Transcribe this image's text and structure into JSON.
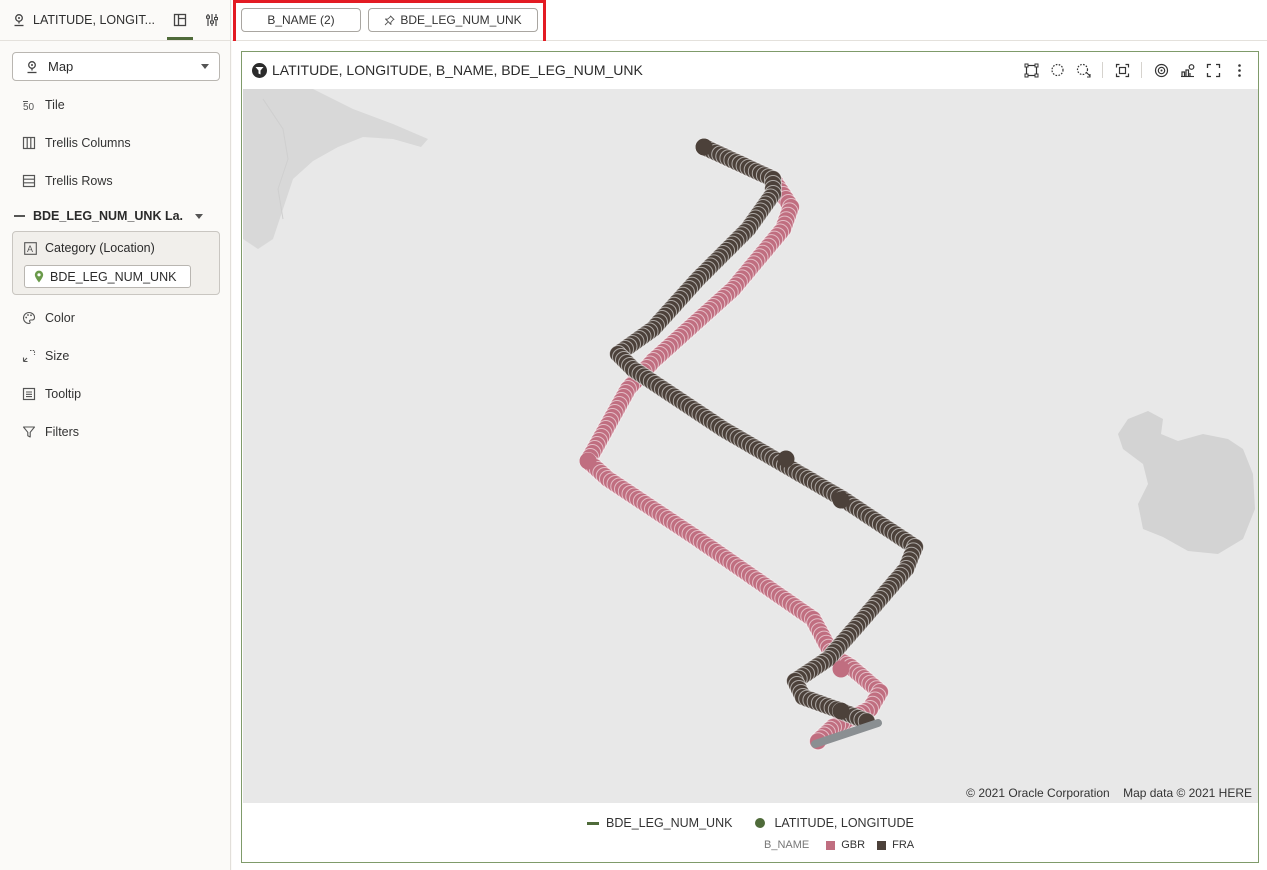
{
  "panel": {
    "title": "LATITUDE, LONGIT...",
    "viz_type": "Map",
    "items": {
      "tile": "Tile",
      "trellis_columns": "Trellis Columns",
      "trellis_rows": "Trellis Rows",
      "color": "Color",
      "size": "Size",
      "tooltip": "Tooltip",
      "filters": "Filters"
    },
    "layer": {
      "label": "BDE_LEG_NUM_UNK La...",
      "category_label": "Category (Location)",
      "category_value": "BDE_LEG_NUM_UNK"
    }
  },
  "filter_bar": {
    "chips": [
      "B_NAME (2)",
      "BDE_LEG_NUM_UNK"
    ]
  },
  "visualization": {
    "title": "LATITUDE, LONGITUDE, B_NAME, BDE_LEG_NUM_UNK",
    "attribution": [
      "© 2021 Oracle Corporation",
      "Map data © 2021 HERE"
    ],
    "legend": {
      "line_item": "BDE_LEG_NUM_UNK",
      "point_item": "LATITUDE, LONGITUDE",
      "color_group": "B_NAME",
      "color_items": [
        {
          "label": "GBR",
          "color": "#c06e80"
        },
        {
          "label": "FRA",
          "color": "#4c413a"
        }
      ]
    },
    "colors": {
      "accent": "#4f6b3a",
      "gbr": "#c06e80",
      "fra": "#4c413a",
      "map_background": "#e8e8e8",
      "land": "#d6d6d6"
    }
  },
  "icons": [
    "map-pin-icon",
    "grammar-tab-icon",
    "properties-tab-icon",
    "tile-icon",
    "trellis-columns-icon",
    "trellis-rows-icon",
    "color-icon",
    "size-icon",
    "tooltip-icon",
    "filter-icon",
    "text-attribute-icon",
    "location-pin-icon",
    "pin-icon",
    "filter-funnel-icon",
    "rect-select-icon",
    "lasso-select-icon",
    "lasso-add-icon",
    "zoom-fit-icon",
    "target-icon",
    "layers-icon",
    "fullscreen-icon",
    "more-menu-icon"
  ]
}
